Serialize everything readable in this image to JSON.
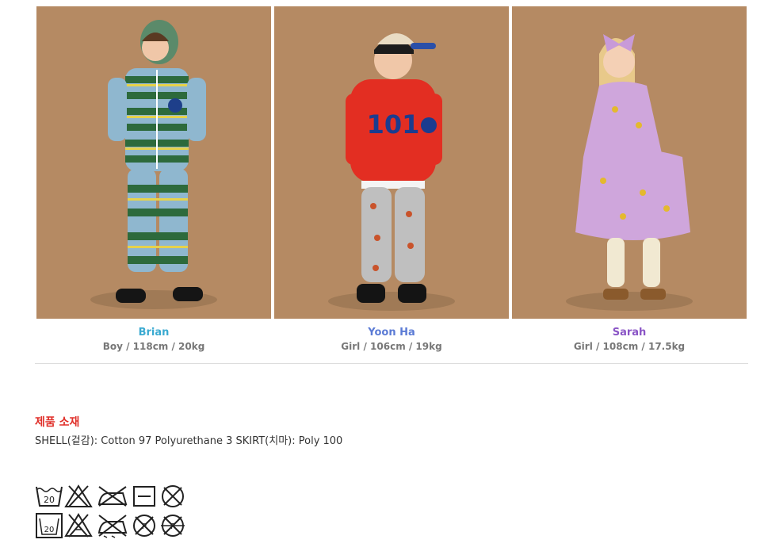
{
  "models": [
    {
      "name": "Brian",
      "info": "Boy / 118cm / 20kg",
      "color": "#3aaad1"
    },
    {
      "name": "Yoon Ha",
      "info": "Girl / 106cm / 19kg",
      "color": "#5b7bd5"
    },
    {
      "name": "Sarah",
      "info": "Girl / 108cm / 17.5kg",
      "color": "#8a55c6"
    }
  ],
  "material": {
    "title": "제품 소재",
    "text": "SHELL(겉감): Cotton 97 Polyurethane 3 SKIRT(치마): Poly 100",
    "title_color": "#e0302a"
  },
  "care_icons": {
    "row1": [
      "wash-30-icon",
      "no-bleach-icon",
      "iron-low-icon",
      "dry-flat-icon",
      "no-tumble-dry-icon"
    ],
    "row2": [
      "machine-wash-30-icon",
      "no-chlorine-bleach-icon",
      "no-steam-iron-icon",
      "no-dry-clean-icon",
      "no-dry-clean-solvent-icon"
    ],
    "labels": {
      "wash_temp": "20",
      "machine_wash_temp": "20",
      "dry_clean_a": "P",
      "dry_clean_b": "F"
    }
  },
  "photo_background": "#b58a63"
}
